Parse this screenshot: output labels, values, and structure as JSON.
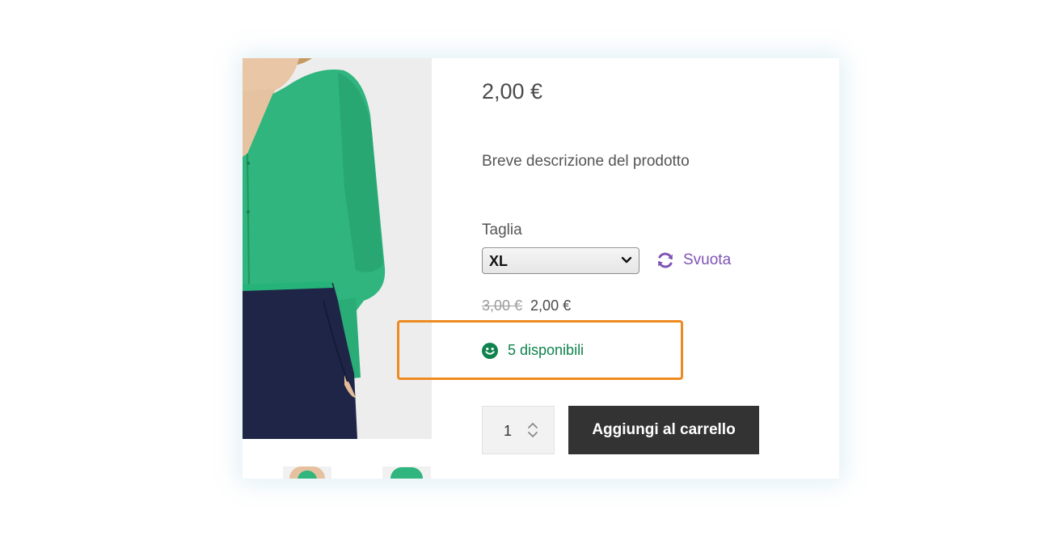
{
  "product": {
    "price": "2,00 €",
    "short_description": "Breve descrizione del prodotto",
    "variation": {
      "label": "Taglia",
      "selected": "XL",
      "reset_label": "Svuota"
    },
    "variant_price": {
      "regular": "3,00 €",
      "sale": "2,00 €"
    },
    "stock": {
      "text": "5 disponibili",
      "icon": "smile-icon"
    },
    "quantity": "1",
    "add_to_cart_label": "Aggiungi al carrello"
  },
  "colors": {
    "stock_green": "#0f834d",
    "link_purple": "#7f54b3",
    "button_dark": "#333333",
    "highlight_orange": "#ee8a1f",
    "shirt_green": "#2fb57d",
    "pants_navy": "#1f2547"
  }
}
